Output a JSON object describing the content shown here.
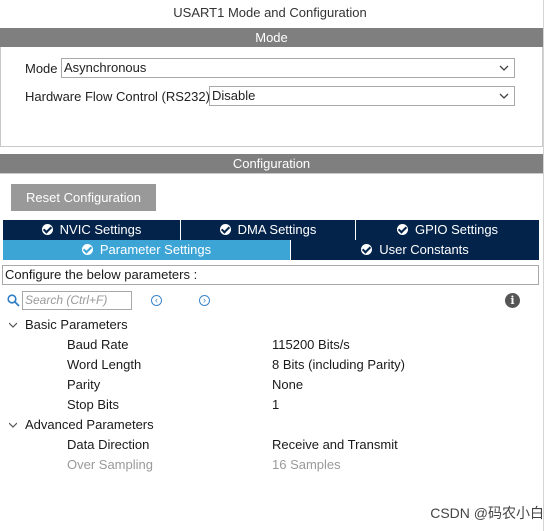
{
  "window_title": "USART1 Mode and Configuration",
  "mode_section": {
    "header": "Mode",
    "mode_label": "Mode",
    "mode_value": "Asynchronous",
    "flow_label": "Hardware Flow Control (RS232)",
    "flow_value": "Disable"
  },
  "config_section": {
    "header": "Configuration",
    "reset_button": "Reset Configuration",
    "tabs_row1": [
      {
        "label": "NVIC Settings"
      },
      {
        "label": "DMA Settings"
      },
      {
        "label": "GPIO Settings"
      }
    ],
    "tabs_row2": [
      {
        "label": "Parameter Settings",
        "active": true
      },
      {
        "label": "User Constants",
        "active": false
      }
    ],
    "description": "Configure the below parameters :",
    "search_placeholder": "Search (Ctrl+F)"
  },
  "parameters": {
    "groups": [
      {
        "name": "Basic Parameters",
        "items": [
          {
            "name": "Baud Rate",
            "value": "115200 Bits/s"
          },
          {
            "name": "Word Length",
            "value": "8 Bits (including Parity)"
          },
          {
            "name": "Parity",
            "value": "None"
          },
          {
            "name": "Stop Bits",
            "value": "1"
          }
        ]
      },
      {
        "name": "Advanced Parameters",
        "items": [
          {
            "name": "Data Direction",
            "value": "Receive and Transmit"
          },
          {
            "name": "Over Sampling",
            "value": "16 Samples",
            "disabled": true
          }
        ]
      }
    ]
  },
  "watermark": "CSDN @码农小白",
  "colors": {
    "section_bar": "#7f7f7f",
    "tab_dark": "#03234b",
    "tab_active": "#3ca5d6",
    "reset_button": "#999999"
  }
}
